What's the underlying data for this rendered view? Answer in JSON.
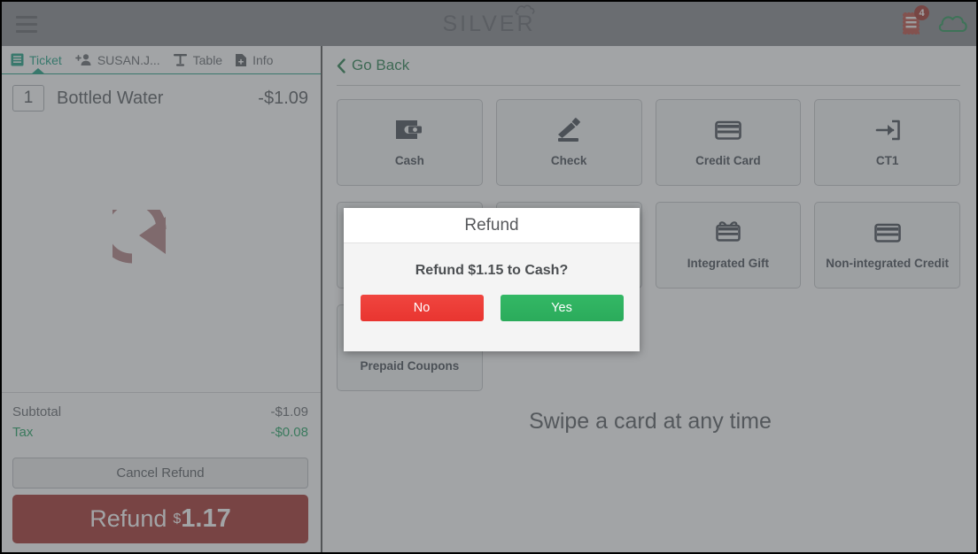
{
  "header": {
    "menu_icon": "hamburger-menu-icon",
    "logo_text": "SILVER",
    "logo_mark": "cloud-icon",
    "orders_icon": "receipt-icon",
    "orders_badge": "4",
    "cloud_status_icon": "cloud-icon",
    "colors": {
      "bar": "#818386",
      "logo": "#5d6166",
      "badge": "#9e2a20",
      "receipt": "#b8453a",
      "cloud": "#1d8f4e"
    }
  },
  "left_panel": {
    "tabs": [
      {
        "label": "Ticket",
        "icon": "ticket-list-icon",
        "active": true
      },
      {
        "label": "SUSAN.J...",
        "icon": "add-customer-icon",
        "active": false
      },
      {
        "label": "Table",
        "icon": "table-icon",
        "active": false
      },
      {
        "label": "Info",
        "icon": "info-document-icon",
        "active": false
      }
    ],
    "items": [
      {
        "qty": "1",
        "name": "Bottled Water",
        "price": "-$1.09"
      }
    ],
    "watermark_icon": "refund-rotate-arrow-icon",
    "totals": [
      {
        "label": "Subtotal",
        "value": "-$1.09",
        "accent": false
      },
      {
        "label": "Tax",
        "value": "-$0.08",
        "accent": true
      }
    ],
    "cancel_button": "Cancel Refund",
    "refund_button": {
      "label": "Refund",
      "currency": "$",
      "amount": "1.17"
    },
    "colors": {
      "active_tab": "#0f9b7c",
      "tax": "#16a05c",
      "refund_button": "#9f2520"
    }
  },
  "main_panel": {
    "go_back": "Go Back",
    "go_back_icon": "chevron-left-icon",
    "tiles": [
      {
        "label": "Cash",
        "icon": "wallet-icon"
      },
      {
        "label": "Check",
        "icon": "pencil-signature-icon"
      },
      {
        "label": "Credit Card",
        "icon": "credit-card-icon"
      },
      {
        "label": "CT1",
        "icon": "arrow-into-box-icon"
      },
      {
        "label": "",
        "icon": "hidden-behind-modal"
      },
      {
        "label": "",
        "icon": "hidden-behind-modal"
      },
      {
        "label": "Integrated Gift",
        "icon": "gift-card-icon"
      },
      {
        "label": "Non-integrated Credit",
        "icon": "credit-card-icon"
      },
      {
        "label": "Prepaid Coupons",
        "icon": "coupon-icon"
      }
    ],
    "swipe_message": "Swipe a card at any time",
    "colors": {
      "go_back": "#1c7a45",
      "tile_icon": "#3b434c"
    }
  },
  "modal": {
    "title": "Refund",
    "message": "Refund $1.15 to Cash?",
    "buttons": [
      {
        "label": "No",
        "role": "decline",
        "color": "#e93530"
      },
      {
        "label": "Yes",
        "role": "confirm",
        "color": "#2bab5b"
      }
    ]
  }
}
